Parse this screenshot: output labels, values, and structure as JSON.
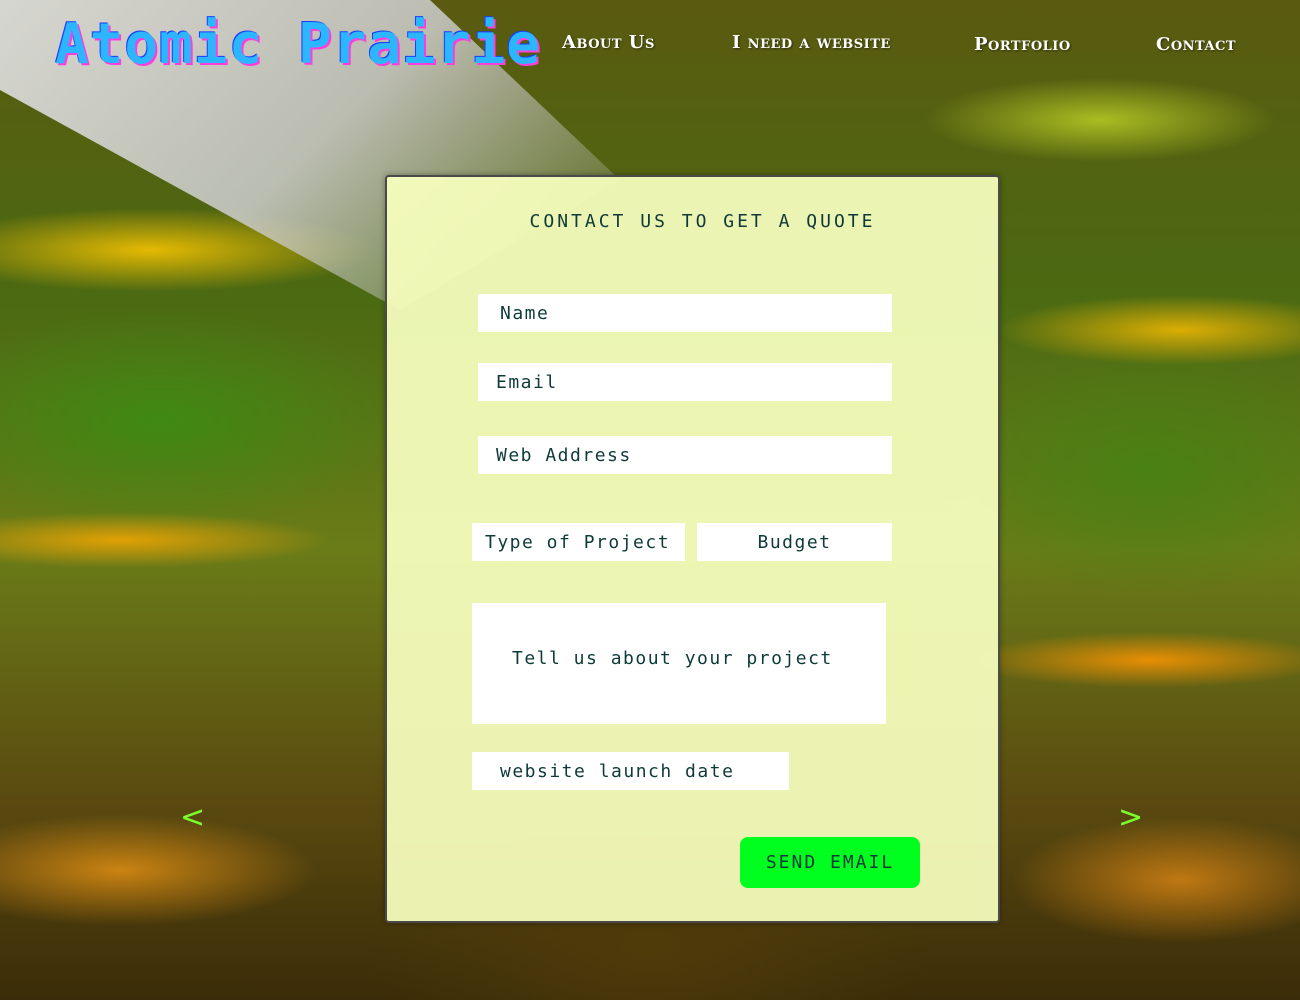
{
  "logo": {
    "text": "Atomic Prairie"
  },
  "nav": {
    "items": [
      {
        "label": "About Us"
      },
      {
        "label": "I need a website"
      },
      {
        "label": "Portfolio"
      },
      {
        "label": "Contact"
      }
    ]
  },
  "form": {
    "title": "CONTACT US TO GET A QUOTE",
    "name_placeholder": "Name",
    "email_placeholder": "Email",
    "web_placeholder": "Web Address",
    "type_placeholder": "Type of Project",
    "budget_placeholder": "Budget",
    "message_placeholder": "Tell us about your project",
    "date_placeholder": "website launch date",
    "send_label": "SEND EMAIL"
  },
  "carousel": {
    "prev": "<",
    "next": ">"
  },
  "colors": {
    "logo": "#2bb6ff",
    "panel": "#f8ffbe",
    "send_button": "#00ff1e",
    "arrows": "#7cff2a"
  }
}
